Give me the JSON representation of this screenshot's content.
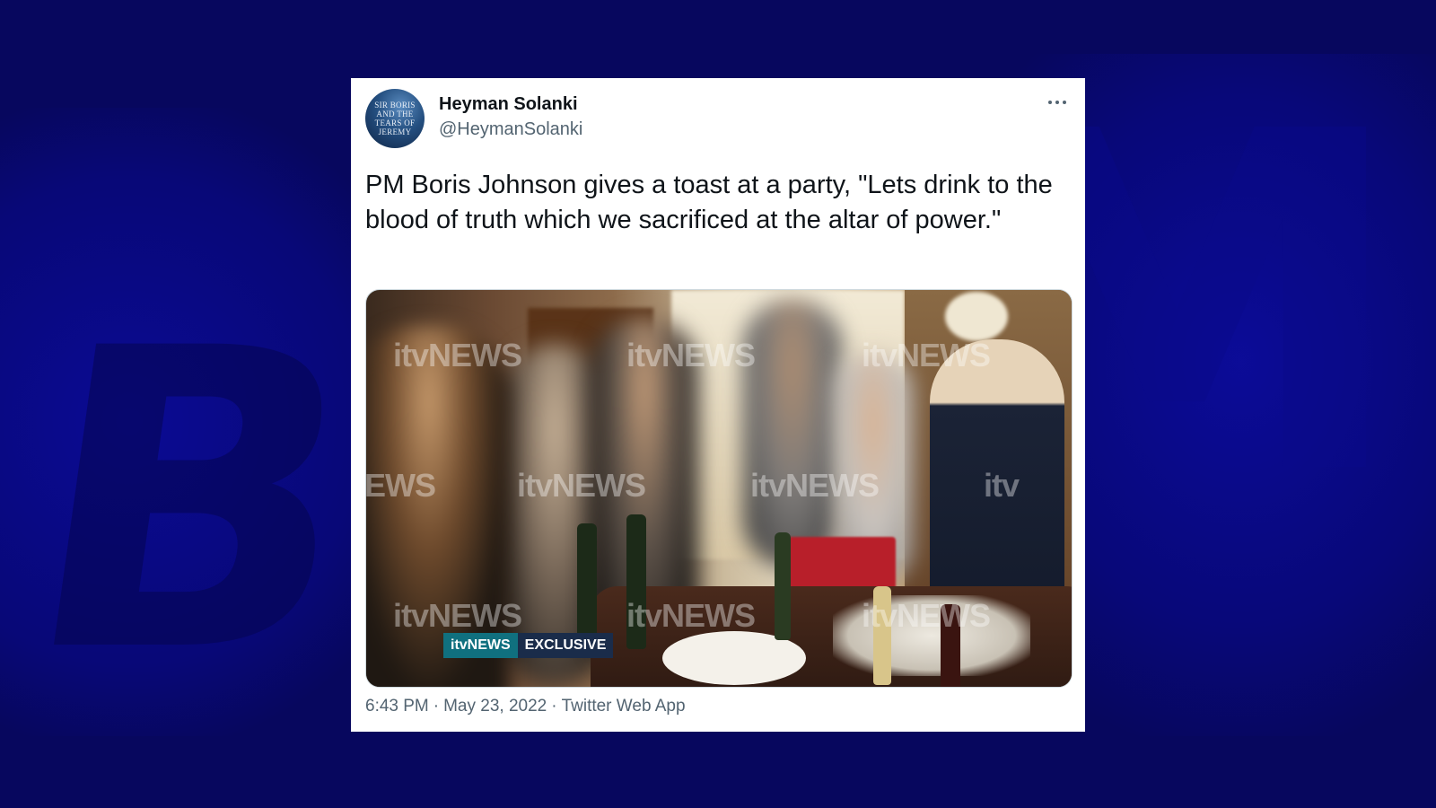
{
  "colors": {
    "background": "#07075e",
    "card": "#ffffff",
    "name_text": "#0f1419",
    "secondary_text": "#536471",
    "news_bug": "#10707f"
  },
  "tweet": {
    "author": {
      "name": "Heyman Solanki",
      "handle": "@HeymanSolanki",
      "avatar_text": [
        "Sir Boris",
        "and the",
        "tears of",
        "Jeremy"
      ]
    },
    "more_icon": "more-horizontal-icon",
    "text": "PM Boris Johnson gives a toast at a party, \"Lets drink to the blood of truth which we sacrificed at the altar of power.\"",
    "media": {
      "watermark": "itvNEWS",
      "watermark_partial_left": "EWS",
      "watermark_partial_right": "itv",
      "bug_brand": "itvNEWS",
      "bug_label": "EXCLUSIVE"
    },
    "meta": {
      "time": "6:43 PM",
      "date": "May 23, 2022",
      "separator": "·",
      "source": "Twitter Web App"
    }
  }
}
